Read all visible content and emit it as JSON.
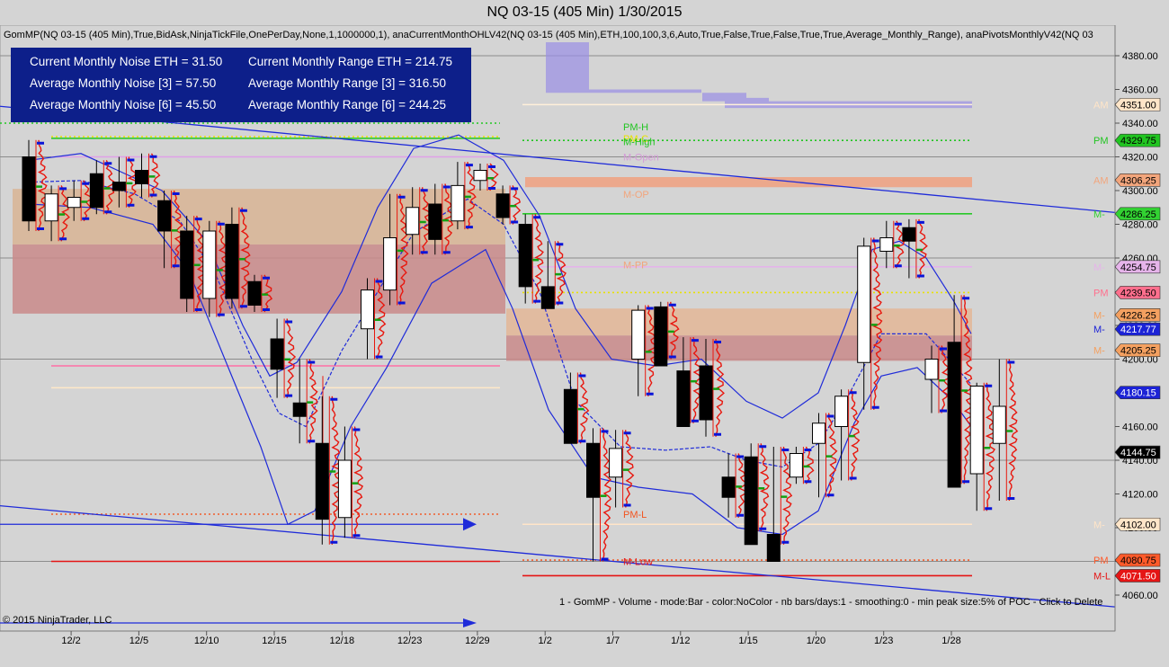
{
  "window": {
    "title": "NQ 03-15 (405 Min)  1/30/2015"
  },
  "indicator_caption": "GomMP(NQ 03-15 (405 Min),True,BidAsk,NinjaTickFile,OnePerDay,None,1,1000000,1), anaCurrentMonthOHLV42(NQ 03-15 (405 Min),ETH,100,100,3,6,Auto,True,False,True,False,True,True,Average_Monthly_Range), anaPivotsMonthlyV42(NQ 03",
  "stats_box": {
    "rows": [
      [
        "Current Monthly Noise ETH = 31.50",
        "Current Monthly Range ETH = 214.75"
      ],
      [
        "Average Monthly Noise [3] = 57.50",
        "Average Monthly Range [3] = 316.50"
      ],
      [
        "Average Monthly Noise [6] = 45.50",
        "Average Monthly Range [6] = 244.25"
      ]
    ]
  },
  "footer_note": "1 - GomMP - Volume - mode:Bar - color:NoColor - nb bars/days:1 - smoothing:0 - min peak size:5% of POC - Click to Delete",
  "copyright": "© 2015 NinjaTrader, LLC",
  "colors": {
    "background": "#d4d4d4",
    "stats_box": "#0d1f8a",
    "trend_line": "#1f2bd9",
    "bull_candle": "#ffffff",
    "bear_candle": "#000000",
    "volume_profile": "#e8170e"
  },
  "chart_data": {
    "type": "candlestick",
    "title": "NQ 03-15 (405 Min)  1/30/2015",
    "ylim": [
      4053,
      4393
    ],
    "y_ticks": [
      4060,
      4080,
      4100,
      4120,
      4140,
      4160,
      4180,
      4200,
      4220,
      4240,
      4260,
      4280,
      4300,
      4320,
      4340,
      4360,
      4380
    ],
    "x_ticks": [
      {
        "label": "12/2",
        "i": 1
      },
      {
        "label": "12/5",
        "i": 4
      },
      {
        "label": "12/10",
        "i": 7
      },
      {
        "label": "12/15",
        "i": 10
      },
      {
        "label": "12/18",
        "i": 13
      },
      {
        "label": "12/23",
        "i": 16
      },
      {
        "label": "12/29",
        "i": 19
      },
      {
        "label": "1/2",
        "i": 22
      },
      {
        "label": "1/7",
        "i": 25
      },
      {
        "label": "1/12",
        "i": 28
      },
      {
        "label": "1/15",
        "i": 31
      },
      {
        "label": "1/20",
        "i": 34
      },
      {
        "label": "1/23",
        "i": 37
      },
      {
        "label": "1/28",
        "i": 40
      }
    ],
    "candles": [
      [
        4320,
        4330,
        4276,
        4282
      ],
      [
        4282,
        4303,
        4270,
        4298
      ],
      [
        4290,
        4306,
        4282,
        4296
      ],
      [
        4310,
        4318,
        4286,
        4290
      ],
      [
        4305,
        4320,
        4290,
        4300
      ],
      [
        4312,
        4322,
        4296,
        4304
      ],
      [
        4294,
        4300,
        4254,
        4276
      ],
      [
        4276,
        4285,
        4228,
        4236
      ],
      [
        4236,
        4282,
        4225,
        4276
      ],
      [
        4280,
        4290,
        4230,
        4236
      ],
      [
        4246,
        4250,
        4228,
        4232
      ],
      [
        4212,
        4224,
        4177,
        4194
      ],
      [
        4174,
        4200,
        4150,
        4166
      ],
      [
        4150,
        4178,
        4090,
        4105
      ],
      [
        4106,
        4160,
        4094,
        4140
      ],
      [
        4218,
        4248,
        4200,
        4241
      ],
      [
        4241,
        4298,
        4232,
        4272
      ],
      [
        4274,
        4302,
        4262,
        4290
      ],
      [
        4292,
        4304,
        4262,
        4271
      ],
      [
        4282,
        4317,
        4277,
        4303
      ],
      [
        4306,
        4316,
        4300,
        4312
      ],
      [
        4298,
        4303,
        4280,
        4284
      ],
      [
        4280,
        4286,
        4233,
        4243
      ],
      [
        4243,
        4270,
        4232,
        4230
      ],
      [
        4182,
        4192,
        4150,
        4150
      ],
      [
        4150,
        4159,
        4080,
        4118
      ],
      [
        4130,
        4158,
        4112,
        4147
      ],
      [
        4200,
        4232,
        4178,
        4229
      ],
      [
        4231,
        4234,
        4200,
        4196
      ],
      [
        4193,
        4213,
        4162,
        4160
      ],
      [
        4196,
        4212,
        4154,
        4164
      ],
      [
        4130,
        4144,
        4106,
        4118
      ],
      [
        4142,
        4150,
        4098,
        4090
      ],
      [
        4096,
        4148,
        4090,
        4080
      ],
      [
        4130,
        4148,
        4126,
        4144
      ],
      [
        4150,
        4168,
        4118,
        4162
      ],
      [
        4160,
        4182,
        4128,
        4178
      ],
      [
        4198,
        4272,
        4170,
        4267
      ],
      [
        4264,
        4282,
        4254,
        4272
      ],
      [
        4278,
        4283,
        4248,
        4270
      ],
      [
        4188,
        4208,
        4168,
        4200
      ],
      [
        4210,
        4238,
        4126,
        4124
      ],
      [
        4132,
        4186,
        4110,
        4184
      ],
      [
        4150,
        4200,
        4116,
        4172
      ]
    ],
    "price_labels": [
      {
        "value": "4351.00",
        "prefix": "AM",
        "color": "#ffe5c8",
        "text_color": "#000000"
      },
      {
        "value": "4329.75",
        "prefix": "PM",
        "color": "#21c521",
        "text_color": "#000000"
      },
      {
        "value": "4306.25",
        "prefix": "AM",
        "color": "#f2a57c",
        "text_color": "#000000"
      },
      {
        "value": "4286.25",
        "prefix": "M-",
        "color": "#32d232",
        "text_color": "#000000"
      },
      {
        "value": "4254.75",
        "prefix": "M-",
        "color": "#e6b4ea",
        "text_color": "#000000"
      },
      {
        "value": "4239.50",
        "prefix": "PM",
        "color": "#ff6f8d",
        "text_color": "#000000"
      },
      {
        "value": "4226.25",
        "prefix": "M-",
        "color": "#f4a060",
        "text_color": "#000000"
      },
      {
        "value": "4217.77",
        "prefix": "M-",
        "color": "#1c23d6",
        "text_color": "#ffffff"
      },
      {
        "value": "4205.25",
        "prefix": "M-",
        "color": "#f4a060",
        "text_color": "#000000"
      },
      {
        "value": "4180.15",
        "prefix": "",
        "color": "#1c23d6",
        "text_color": "#ffffff"
      },
      {
        "value": "4144.75",
        "prefix": "",
        "color": "#000000",
        "text_color": "#ffffff"
      },
      {
        "value": "4102.00",
        "prefix": "M-",
        "color": "#ffe5c8",
        "text_color": "#000000"
      },
      {
        "value": "4080.75",
        "prefix": "PM",
        "color": "#ff5a2a",
        "text_color": "#000000"
      },
      {
        "value": "4071.50",
        "prefix": "M-L",
        "color": "#e51515",
        "text_color": "#ffffff"
      }
    ],
    "level_labels": [
      "PM-H",
      "PM-C",
      "M-High",
      "M-Open",
      "M-OP",
      "M-PP",
      "PM-L",
      "M-Low"
    ]
  }
}
